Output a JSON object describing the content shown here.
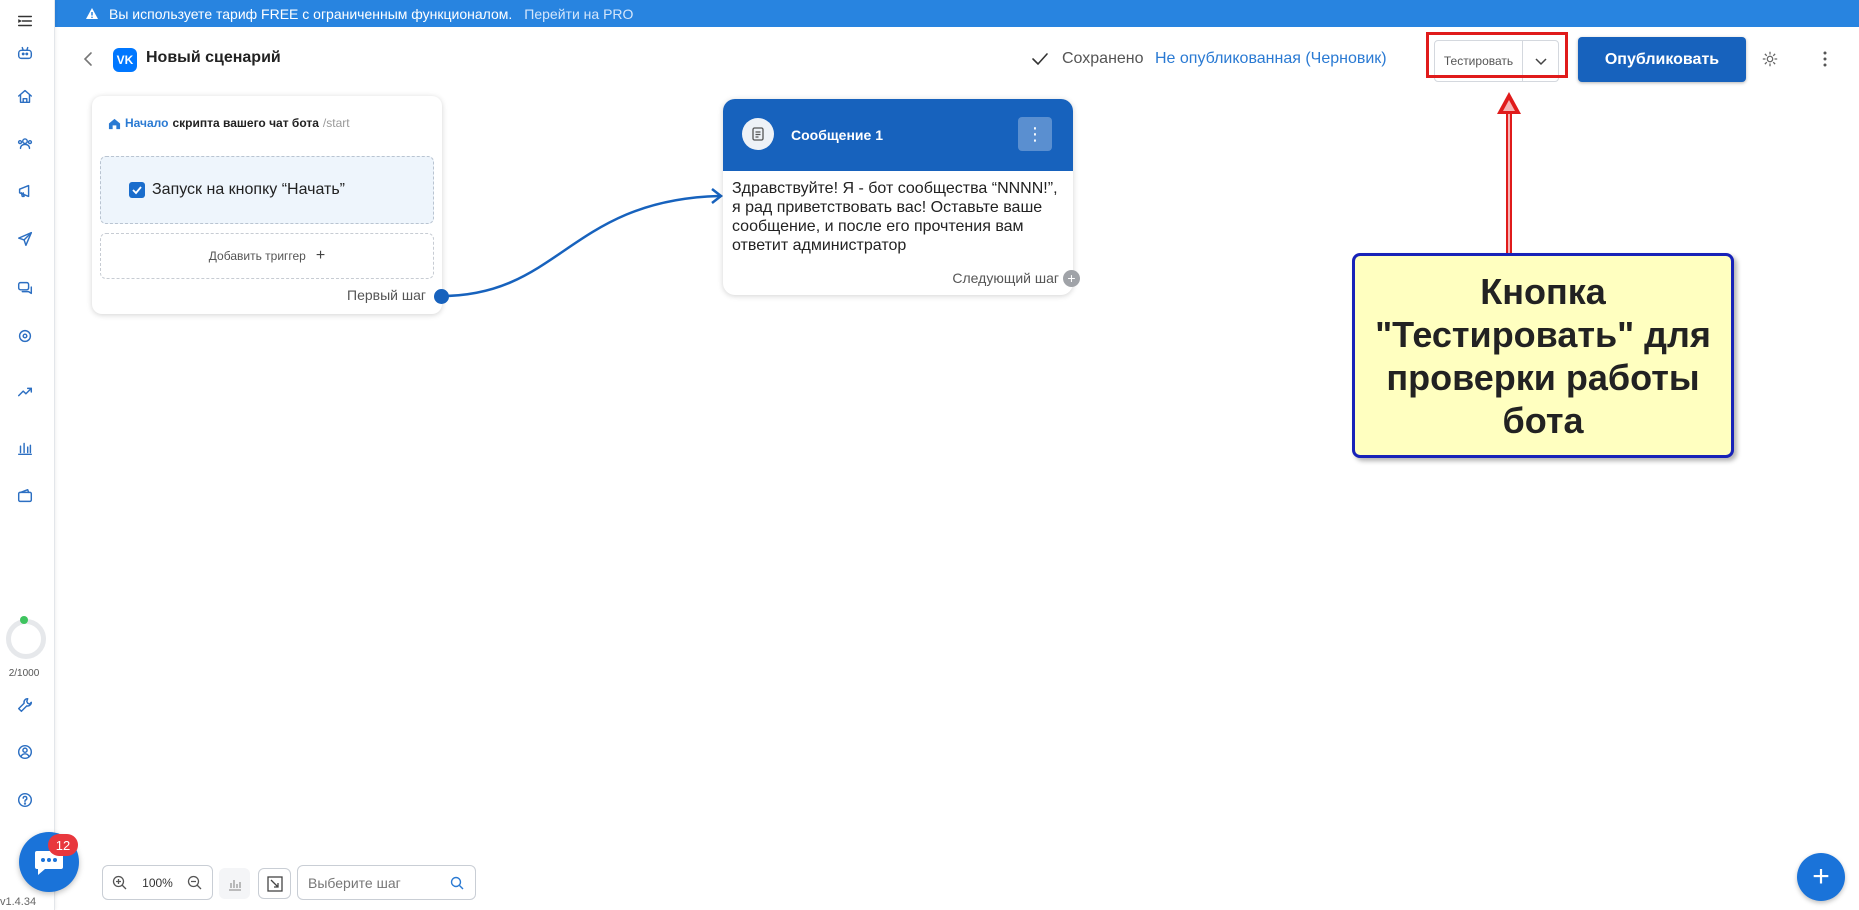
{
  "banner": {
    "text": "Вы используете тариф FREE с ограниченным функционалом.",
    "link": "Перейти на PRO"
  },
  "header": {
    "title": "Новый сценарий",
    "logo_text": "VK",
    "saved": "Сохранено",
    "status": "Не опубликованная (Черновик)",
    "test_label": "Тестировать",
    "publish_label": "Опубликовать"
  },
  "sidebar": {
    "icons": [
      "menu-icon",
      "bot-icon",
      "home-icon",
      "users-icon",
      "broadcast-icon",
      "send-icon",
      "chats-icon",
      "integrations-icon",
      "trending-icon",
      "stats-icon",
      "wallet-icon",
      "wrench-icon",
      "profile-icon",
      "help-icon"
    ],
    "usage": "2/1000",
    "chat_badge": "12",
    "version": "v1.4.34"
  },
  "start_card": {
    "start_label": "Начало",
    "script_label": "скрипта вашего чат бота",
    "command": "/start",
    "trigger_label": "Запуск на кнопку “Начать”",
    "add_trigger": "Добавить триггер",
    "first_step": "Первый шаг"
  },
  "message_card": {
    "title": "Сообщение 1",
    "body": "Здравствуйте! Я - бот сообщества “NNNN!”, я рад приветствовать вас! Оставьте ваше сообщение, и после его прочтения вам ответит администратор",
    "next_step": "Следующий шаг"
  },
  "callout": {
    "text": "Кнопка \"Тестировать\" для проверки работы бота"
  },
  "toolbar": {
    "zoom": "100%",
    "search_placeholder": "Выберите шаг"
  },
  "colors": {
    "primary": "#1762bd",
    "banner": "#2884e0",
    "callout_bg": "#ffffc0",
    "callout_border": "#1722b8",
    "highlight": "#e01b1b"
  }
}
